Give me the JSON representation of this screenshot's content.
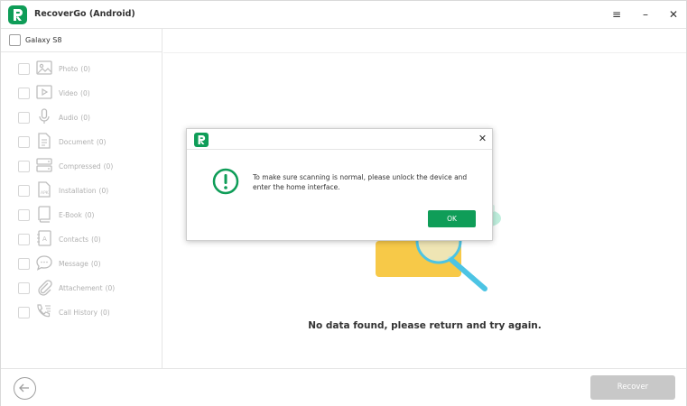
{
  "app": {
    "title": "RecoverGo (Android)",
    "brand_color": "#0f9d58",
    "window_controls": {
      "menu": "≡",
      "minimize": "–",
      "close": "✕"
    }
  },
  "sidebar": {
    "device": "Galaxy S8",
    "items": [
      {
        "label": "Photo",
        "count": "(0)",
        "icon": "photo-icon"
      },
      {
        "label": "Video",
        "count": "(0)",
        "icon": "video-icon"
      },
      {
        "label": "Audio",
        "count": "(0)",
        "icon": "microphone-icon"
      },
      {
        "label": "Document",
        "count": "(0)",
        "icon": "document-icon"
      },
      {
        "label": "Compressed",
        "count": "(0)",
        "icon": "archive-icon"
      },
      {
        "label": "Installation",
        "count": "(0)",
        "icon": "apk-icon"
      },
      {
        "label": "E-Book",
        "count": "(0)",
        "icon": "book-icon"
      },
      {
        "label": "Contacts",
        "count": "(0)",
        "icon": "contacts-icon"
      },
      {
        "label": "Message",
        "count": "(0)",
        "icon": "message-icon"
      },
      {
        "label": "Attachement",
        "count": "(0)",
        "icon": "attachment-icon"
      },
      {
        "label": "Call History",
        "count": "(0)",
        "icon": "call-history-icon"
      }
    ]
  },
  "main": {
    "empty_message": "No data found, please return and try again."
  },
  "footer": {
    "recover_label": "Recover"
  },
  "dialog": {
    "message": "To make sure scanning is normal, please unlock the device and enter the home interface.",
    "ok_label": "OK",
    "close": "✕"
  }
}
